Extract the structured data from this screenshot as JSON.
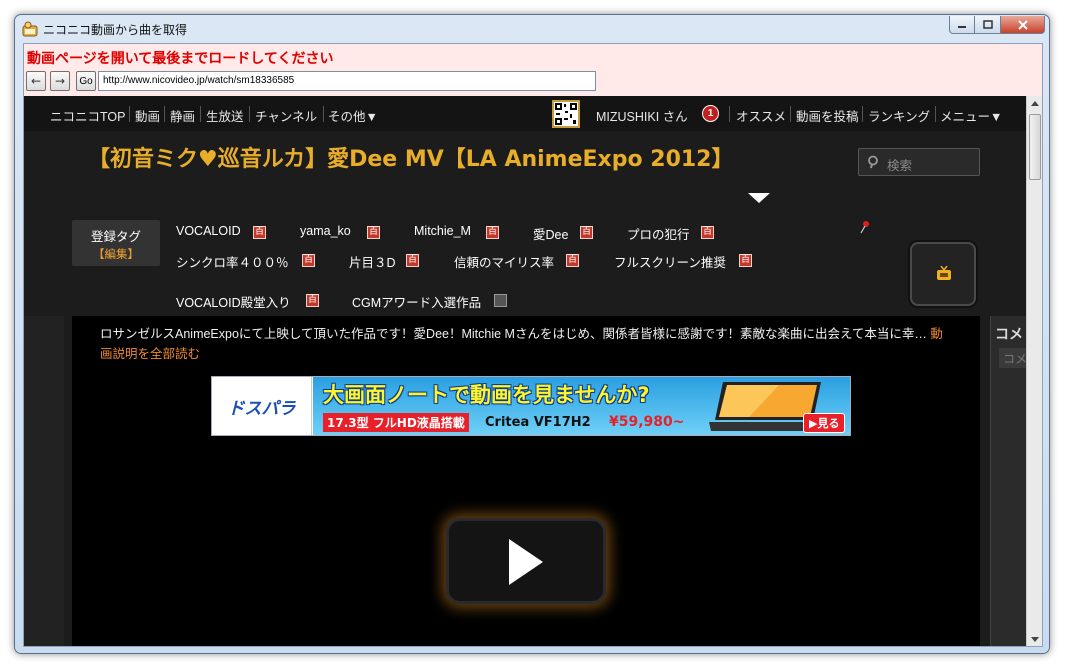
{
  "window": {
    "title": "ニコニコ動画から曲を取得"
  },
  "instruction": "動画ページを開いて最後までロードしてください",
  "nav": {
    "back": "←",
    "forward": "→",
    "go": "Go",
    "url": "http://www.nicovideo.jp/watch/sm18336585"
  },
  "site_menu": {
    "items": [
      "ニコニコTOP",
      "動画",
      "静画",
      "生放送",
      "チャンネル",
      "その他▼"
    ],
    "user": "MIZUSHIKI さん",
    "notification_count": "1",
    "right_items": [
      "オススメ",
      "動画を投稿",
      "ランキング",
      "メニュー▼"
    ]
  },
  "video": {
    "title": "【初音ミク♥巡音ルカ】愛Dee MV【LA AnimeExpo 2012】",
    "search_placeholder": "検索"
  },
  "tags": {
    "label": "登録タグ",
    "edit": "【編集】",
    "dic_mark": "百",
    "items": [
      "VOCALOID",
      "yama_ko",
      "Mitchie_M",
      "愛Dee",
      "プロの犯行",
      "シンクロ率４００％",
      "片目３D",
      "信頼のマイリス率",
      "フルスクリーン推奨",
      "VOCALOID殿堂入り",
      "CGMアワード入選作品"
    ]
  },
  "description": {
    "text": "ロサンゼルスAnimeExpoにて上映して頂いた作品です！愛Dee！Mitchie Mさんをはじめ、関係者皆様に感謝です！素敵な楽曲に出会えて本当に幸…",
    "more": "動画説明を全部読む"
  },
  "ad": {
    "logo": "ドスパラ",
    "headline": "大画面ノートで動画を見ませんか?",
    "spec": "17.3型 フルHD液晶搭載",
    "model": "Critea VF17H2",
    "price": "¥59,980~",
    "cta": "▶見る"
  },
  "right_panel": {
    "title": "コメ",
    "sub": "コメ"
  },
  "colors": {
    "accent": "#e8ae2a",
    "page_bg": "#1c1c1c",
    "instruction": "#e00000",
    "link": "#f08a30"
  }
}
